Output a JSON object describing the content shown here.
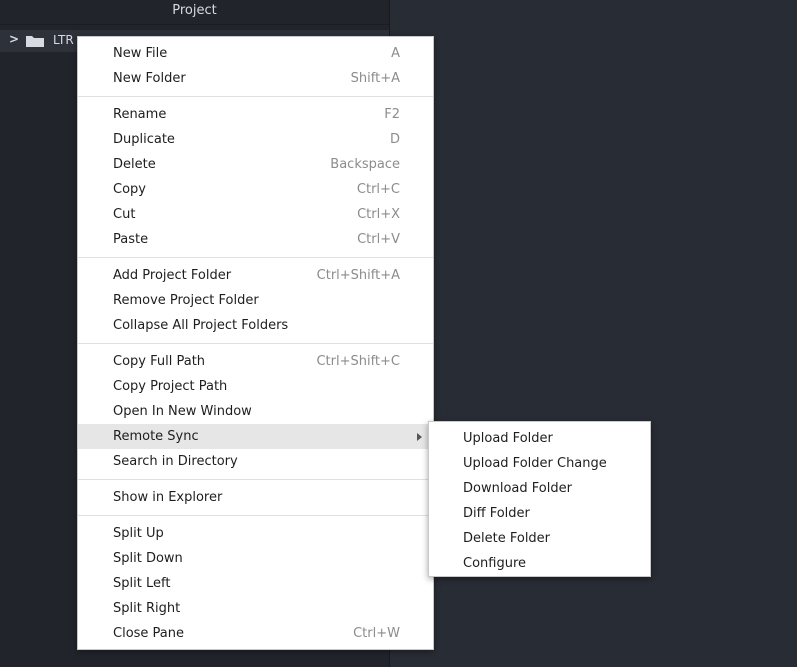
{
  "panel": {
    "title": "Project",
    "root_folder": "LTR"
  },
  "menu": {
    "groups": [
      [
        {
          "label": "New File",
          "shortcut": "A"
        },
        {
          "label": "New Folder",
          "shortcut": "Shift+A"
        }
      ],
      [
        {
          "label": "Rename",
          "shortcut": "F2"
        },
        {
          "label": "Duplicate",
          "shortcut": "D"
        },
        {
          "label": "Delete",
          "shortcut": "Backspace"
        },
        {
          "label": "Copy",
          "shortcut": "Ctrl+C"
        },
        {
          "label": "Cut",
          "shortcut": "Ctrl+X"
        },
        {
          "label": "Paste",
          "shortcut": "Ctrl+V"
        }
      ],
      [
        {
          "label": "Add Project Folder",
          "shortcut": "Ctrl+Shift+A"
        },
        {
          "label": "Remove Project Folder",
          "shortcut": ""
        },
        {
          "label": "Collapse All Project Folders",
          "shortcut": ""
        }
      ],
      [
        {
          "label": "Copy Full Path",
          "shortcut": "Ctrl+Shift+C"
        },
        {
          "label": "Copy Project Path",
          "shortcut": ""
        },
        {
          "label": "Open In New Window",
          "shortcut": ""
        },
        {
          "label": "Remote Sync",
          "shortcut": "",
          "submenu": true,
          "highlighted": true
        },
        {
          "label": "Search in Directory",
          "shortcut": ""
        }
      ],
      [
        {
          "label": "Show in Explorer",
          "shortcut": ""
        }
      ],
      [
        {
          "label": "Split Up",
          "shortcut": ""
        },
        {
          "label": "Split Down",
          "shortcut": ""
        },
        {
          "label": "Split Left",
          "shortcut": ""
        },
        {
          "label": "Split Right",
          "shortcut": ""
        },
        {
          "label": "Close Pane",
          "shortcut": "Ctrl+W"
        }
      ]
    ]
  },
  "submenu": {
    "items": [
      {
        "label": "Upload Folder"
      },
      {
        "label": "Upload Folder Change"
      },
      {
        "label": "Download Folder"
      },
      {
        "label": "Diff Folder"
      },
      {
        "label": "Delete Folder"
      },
      {
        "label": "Configure"
      }
    ]
  },
  "colors": {
    "panel_bg": "#21252b",
    "editor_bg": "#282c34",
    "menu_bg": "#ffffff",
    "highlight": "#e6e6e6"
  }
}
